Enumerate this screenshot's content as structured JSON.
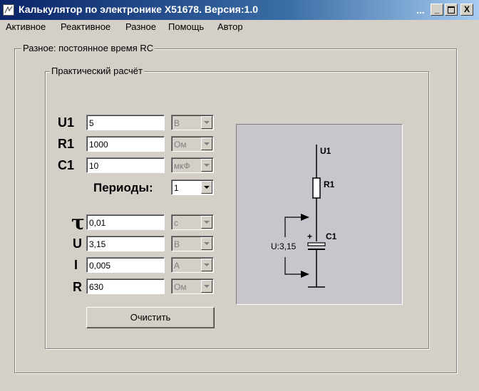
{
  "window": {
    "title": "Калькулятор по электронике X51678. Версия:1.0",
    "menu_hidden_indicator": "...",
    "minimize_label": "_",
    "close_label": "X"
  },
  "menu": [
    "Активное",
    "Реактивное",
    "Разное",
    "Помощь",
    "Автор"
  ],
  "outer_group": "Разное: постоянное время RC",
  "inner_group": "Практический расчёт",
  "inputs": [
    {
      "label": "U1",
      "value": "5",
      "unit": "В"
    },
    {
      "label": "R1",
      "value": "1000",
      "unit": "Ом"
    },
    {
      "label": "C1",
      "value": "10",
      "unit": "мкФ"
    }
  ],
  "periods": {
    "label": "Периоды:",
    "value": "1"
  },
  "results": [
    {
      "label": "τ",
      "value": "0,01",
      "unit": "с"
    },
    {
      "label": "U",
      "value": "3,15",
      "unit": "В"
    },
    {
      "label": "I",
      "value": "0,005",
      "unit": "А"
    },
    {
      "label": "R",
      "value": "630",
      "unit": "Ом"
    }
  ],
  "clear_button": "Очистить",
  "schematic": {
    "u1_label": "U1",
    "r1_label": "R1",
    "c1_label": "C1",
    "plus_label": "+",
    "voltage_label": "U:3,15"
  }
}
